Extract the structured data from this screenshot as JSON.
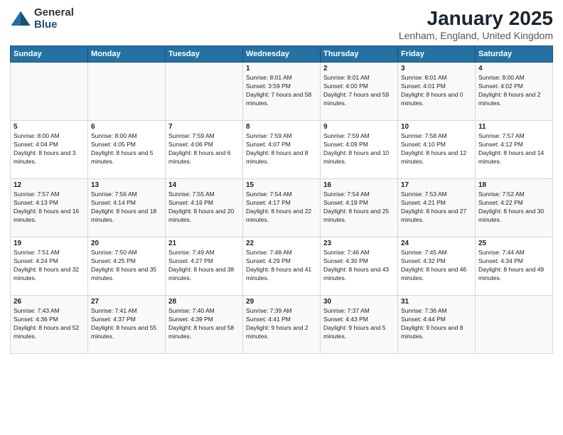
{
  "logo": {
    "general": "General",
    "blue": "Blue"
  },
  "header": {
    "title": "January 2025",
    "location": "Lenham, England, United Kingdom"
  },
  "weekdays": [
    "Sunday",
    "Monday",
    "Tuesday",
    "Wednesday",
    "Thursday",
    "Friday",
    "Saturday"
  ],
  "weeks": [
    [
      {
        "day": "",
        "sunrise": "",
        "sunset": "",
        "daylight": ""
      },
      {
        "day": "",
        "sunrise": "",
        "sunset": "",
        "daylight": ""
      },
      {
        "day": "",
        "sunrise": "",
        "sunset": "",
        "daylight": ""
      },
      {
        "day": "1",
        "sunrise": "Sunrise: 8:01 AM",
        "sunset": "Sunset: 3:59 PM",
        "daylight": "Daylight: 7 hours and 58 minutes."
      },
      {
        "day": "2",
        "sunrise": "Sunrise: 8:01 AM",
        "sunset": "Sunset: 4:00 PM",
        "daylight": "Daylight: 7 hours and 59 minutes."
      },
      {
        "day": "3",
        "sunrise": "Sunrise: 8:01 AM",
        "sunset": "Sunset: 4:01 PM",
        "daylight": "Daylight: 8 hours and 0 minutes."
      },
      {
        "day": "4",
        "sunrise": "Sunrise: 8:00 AM",
        "sunset": "Sunset: 4:02 PM",
        "daylight": "Daylight: 8 hours and 2 minutes."
      }
    ],
    [
      {
        "day": "5",
        "sunrise": "Sunrise: 8:00 AM",
        "sunset": "Sunset: 4:04 PM",
        "daylight": "Daylight: 8 hours and 3 minutes."
      },
      {
        "day": "6",
        "sunrise": "Sunrise: 8:00 AM",
        "sunset": "Sunset: 4:05 PM",
        "daylight": "Daylight: 8 hours and 5 minutes."
      },
      {
        "day": "7",
        "sunrise": "Sunrise: 7:59 AM",
        "sunset": "Sunset: 4:06 PM",
        "daylight": "Daylight: 8 hours and 6 minutes."
      },
      {
        "day": "8",
        "sunrise": "Sunrise: 7:59 AM",
        "sunset": "Sunset: 4:07 PM",
        "daylight": "Daylight: 8 hours and 8 minutes."
      },
      {
        "day": "9",
        "sunrise": "Sunrise: 7:59 AM",
        "sunset": "Sunset: 4:09 PM",
        "daylight": "Daylight: 8 hours and 10 minutes."
      },
      {
        "day": "10",
        "sunrise": "Sunrise: 7:58 AM",
        "sunset": "Sunset: 4:10 PM",
        "daylight": "Daylight: 8 hours and 12 minutes."
      },
      {
        "day": "11",
        "sunrise": "Sunrise: 7:57 AM",
        "sunset": "Sunset: 4:12 PM",
        "daylight": "Daylight: 8 hours and 14 minutes."
      }
    ],
    [
      {
        "day": "12",
        "sunrise": "Sunrise: 7:57 AM",
        "sunset": "Sunset: 4:13 PM",
        "daylight": "Daylight: 8 hours and 16 minutes."
      },
      {
        "day": "13",
        "sunrise": "Sunrise: 7:56 AM",
        "sunset": "Sunset: 4:14 PM",
        "daylight": "Daylight: 8 hours and 18 minutes."
      },
      {
        "day": "14",
        "sunrise": "Sunrise: 7:55 AM",
        "sunset": "Sunset: 4:16 PM",
        "daylight": "Daylight: 8 hours and 20 minutes."
      },
      {
        "day": "15",
        "sunrise": "Sunrise: 7:54 AM",
        "sunset": "Sunset: 4:17 PM",
        "daylight": "Daylight: 8 hours and 22 minutes."
      },
      {
        "day": "16",
        "sunrise": "Sunrise: 7:54 AM",
        "sunset": "Sunset: 4:19 PM",
        "daylight": "Daylight: 8 hours and 25 minutes."
      },
      {
        "day": "17",
        "sunrise": "Sunrise: 7:53 AM",
        "sunset": "Sunset: 4:21 PM",
        "daylight": "Daylight: 8 hours and 27 minutes."
      },
      {
        "day": "18",
        "sunrise": "Sunrise: 7:52 AM",
        "sunset": "Sunset: 4:22 PM",
        "daylight": "Daylight: 8 hours and 30 minutes."
      }
    ],
    [
      {
        "day": "19",
        "sunrise": "Sunrise: 7:51 AM",
        "sunset": "Sunset: 4:24 PM",
        "daylight": "Daylight: 8 hours and 32 minutes."
      },
      {
        "day": "20",
        "sunrise": "Sunrise: 7:50 AM",
        "sunset": "Sunset: 4:25 PM",
        "daylight": "Daylight: 8 hours and 35 minutes."
      },
      {
        "day": "21",
        "sunrise": "Sunrise: 7:49 AM",
        "sunset": "Sunset: 4:27 PM",
        "daylight": "Daylight: 8 hours and 38 minutes."
      },
      {
        "day": "22",
        "sunrise": "Sunrise: 7:48 AM",
        "sunset": "Sunset: 4:29 PM",
        "daylight": "Daylight: 8 hours and 41 minutes."
      },
      {
        "day": "23",
        "sunrise": "Sunrise: 7:46 AM",
        "sunset": "Sunset: 4:30 PM",
        "daylight": "Daylight: 8 hours and 43 minutes."
      },
      {
        "day": "24",
        "sunrise": "Sunrise: 7:45 AM",
        "sunset": "Sunset: 4:32 PM",
        "daylight": "Daylight: 8 hours and 46 minutes."
      },
      {
        "day": "25",
        "sunrise": "Sunrise: 7:44 AM",
        "sunset": "Sunset: 4:34 PM",
        "daylight": "Daylight: 8 hours and 49 minutes."
      }
    ],
    [
      {
        "day": "26",
        "sunrise": "Sunrise: 7:43 AM",
        "sunset": "Sunset: 4:36 PM",
        "daylight": "Daylight: 8 hours and 52 minutes."
      },
      {
        "day": "27",
        "sunrise": "Sunrise: 7:41 AM",
        "sunset": "Sunset: 4:37 PM",
        "daylight": "Daylight: 8 hours and 55 minutes."
      },
      {
        "day": "28",
        "sunrise": "Sunrise: 7:40 AM",
        "sunset": "Sunset: 4:39 PM",
        "daylight": "Daylight: 8 hours and 58 minutes."
      },
      {
        "day": "29",
        "sunrise": "Sunrise: 7:39 AM",
        "sunset": "Sunset: 4:41 PM",
        "daylight": "Daylight: 9 hours and 2 minutes."
      },
      {
        "day": "30",
        "sunrise": "Sunrise: 7:37 AM",
        "sunset": "Sunset: 4:43 PM",
        "daylight": "Daylight: 9 hours and 5 minutes."
      },
      {
        "day": "31",
        "sunrise": "Sunrise: 7:36 AM",
        "sunset": "Sunset: 4:44 PM",
        "daylight": "Daylight: 9 hours and 8 minutes."
      },
      {
        "day": "",
        "sunrise": "",
        "sunset": "",
        "daylight": ""
      }
    ]
  ]
}
